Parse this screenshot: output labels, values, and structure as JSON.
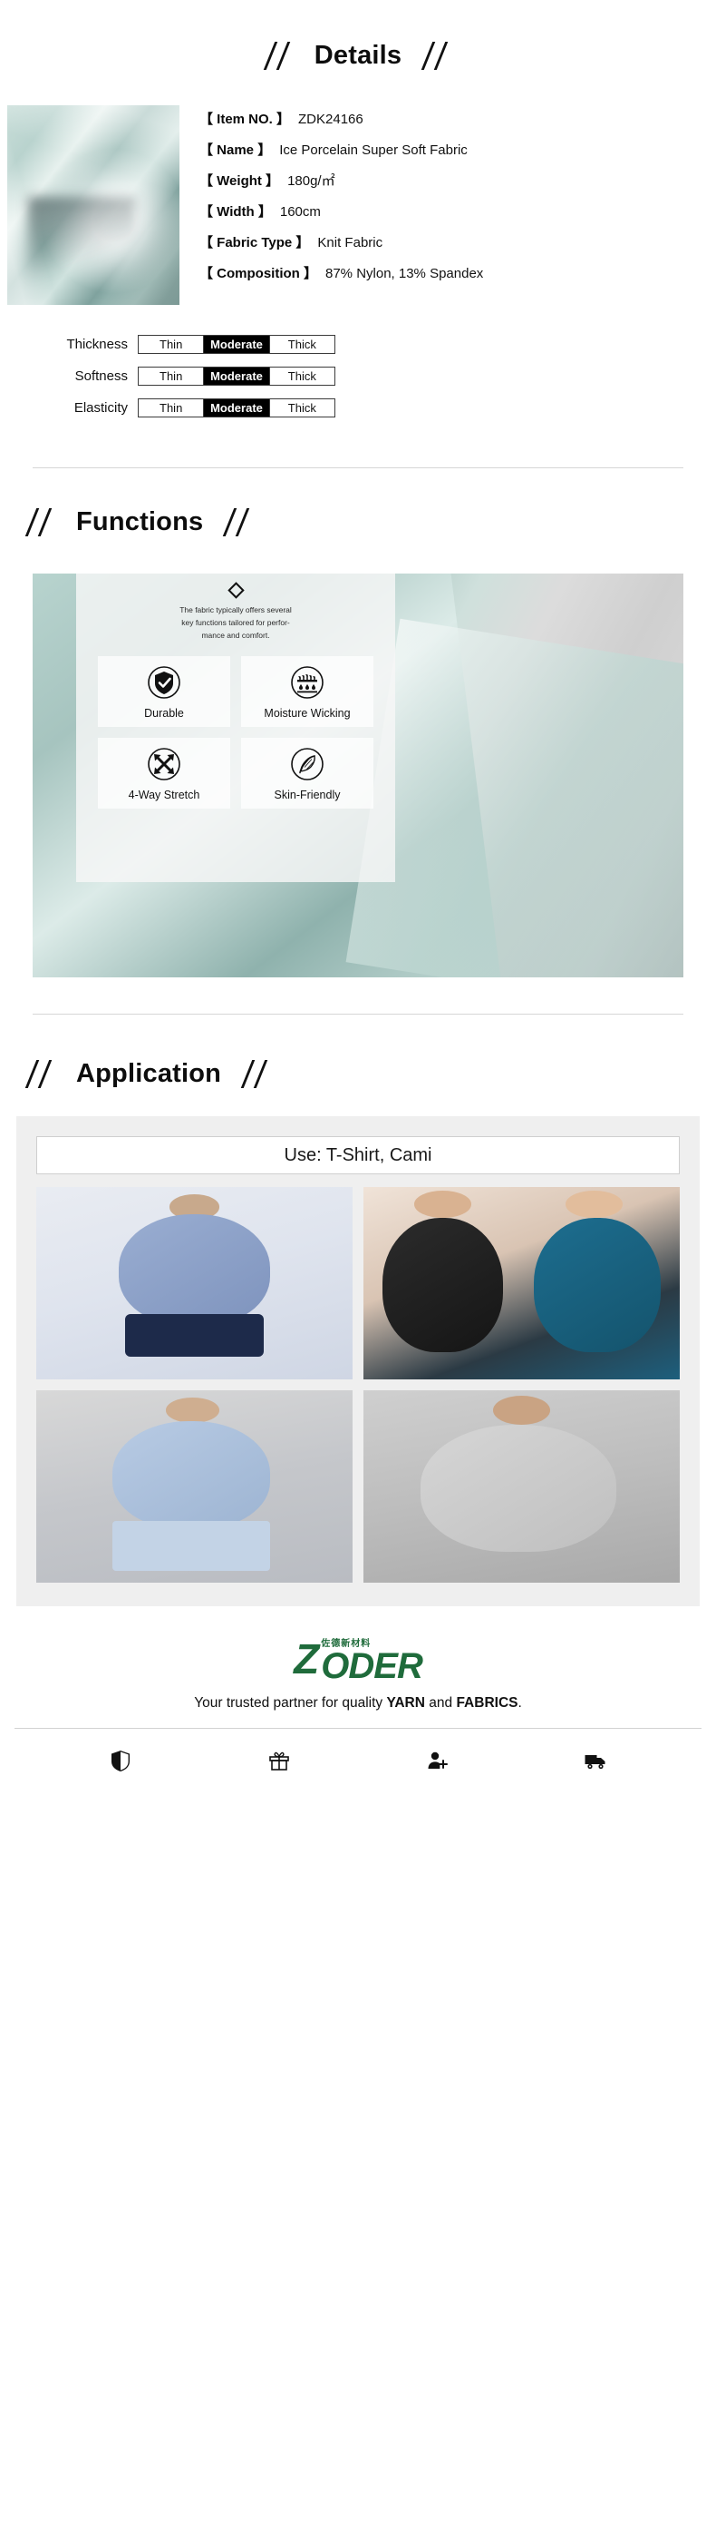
{
  "details": {
    "heading": "Details",
    "specs": [
      {
        "key": "【 Item NO. 】",
        "value": "ZDK24166"
      },
      {
        "key": "【 Name 】",
        "value": "Ice Porcelain Super Soft Fabric"
      },
      {
        "key": "【 Weight 】",
        "value": "180g/㎡"
      },
      {
        "key": "【 Width 】",
        "value": "160cm"
      },
      {
        "key": "【 Fabric Type 】",
        "value": "Knit Fabric"
      },
      {
        "key": "【 Composition 】",
        "value": "87% Nylon, 13% Spandex"
      }
    ],
    "ratings": [
      {
        "label": "Thickness",
        "options": [
          "Thin",
          "Moderate",
          "Thick"
        ],
        "selected": "Moderate"
      },
      {
        "label": "Softness",
        "options": [
          "Thin",
          "Moderate",
          "Thick"
        ],
        "selected": "Moderate"
      },
      {
        "label": "Elasticity",
        "options": [
          "Thin",
          "Moderate",
          "Thick"
        ],
        "selected": "Moderate"
      }
    ]
  },
  "functions": {
    "heading": "Functions",
    "description": "The fabric typically offers several\nkey functions tailored for perfor-\nmance and comfort.",
    "items": [
      {
        "label": "Durable",
        "icon": "shield-check-icon"
      },
      {
        "label": "Moisture Wicking",
        "icon": "moisture-wicking-icon"
      },
      {
        "label": "4-Way Stretch",
        "icon": "four-way-stretch-icon"
      },
      {
        "label": "Skin-Friendly",
        "icon": "feather-icon"
      }
    ]
  },
  "application": {
    "heading": "Application",
    "use_label": "Use: T-Shirt, Cami",
    "photos": [
      {
        "alt": "woman-blue-tshirt"
      },
      {
        "alt": "two-women-cami-tops"
      },
      {
        "alt": "woman-light-blue-tee"
      },
      {
        "alt": "man-grey-tshirt"
      }
    ]
  },
  "footer": {
    "brand": "ODER",
    "brand_mark": "Z",
    "brand_cn": "佐德新材料",
    "tagline_prefix": "Your trusted partner for quality ",
    "tagline_bold1": "YARN",
    "tagline_mid": " and ",
    "tagline_bold2": "FABRICS",
    "tagline_suffix": ".",
    "icons": [
      "shield-icon",
      "gift-icon",
      "user-add-icon",
      "truck-icon"
    ]
  },
  "colors": {
    "brand_green": "#1f6b3b",
    "fabric_teal": "#b5d0cb",
    "selected_black": "#000000"
  }
}
